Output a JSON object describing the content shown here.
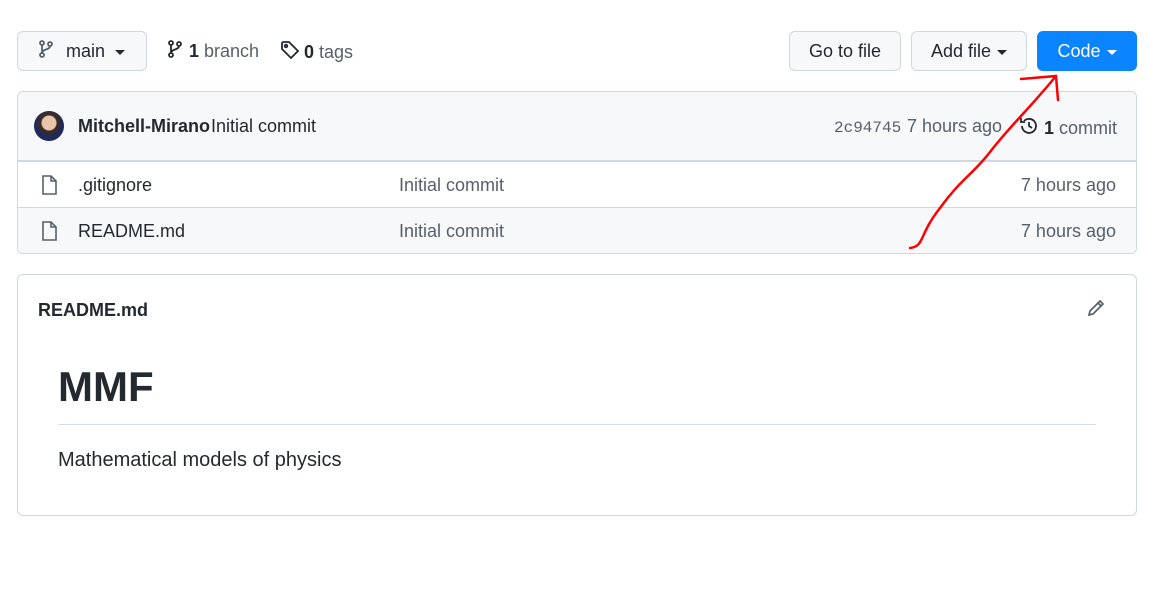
{
  "toolbar": {
    "branch_name": "main",
    "branch_count": "1",
    "branch_label": "branch",
    "tag_count": "0",
    "tag_label": "tags",
    "goto_file_label": "Go to file",
    "add_file_label": "Add file",
    "code_label": "Code"
  },
  "latest_commit": {
    "author": "Mitchell-Mirano",
    "message": "Initial commit",
    "sha": "2c94745",
    "time": "7 hours ago",
    "count": "1",
    "count_label": "commit"
  },
  "files": [
    {
      "name": ".gitignore",
      "commit": "Initial commit",
      "time": "7 hours ago"
    },
    {
      "name": "README.md",
      "commit": "Initial commit",
      "time": "7 hours ago"
    }
  ],
  "readme": {
    "filename": "README.md",
    "heading": "MMF",
    "paragraph": "Mathematical models of physics"
  },
  "colors": {
    "accent_button": "#0a84ff",
    "annotation_arrow": "#ff0000"
  },
  "icons": [
    "branch-icon",
    "tag-icon",
    "history-icon",
    "file-icon",
    "pencil-icon"
  ]
}
